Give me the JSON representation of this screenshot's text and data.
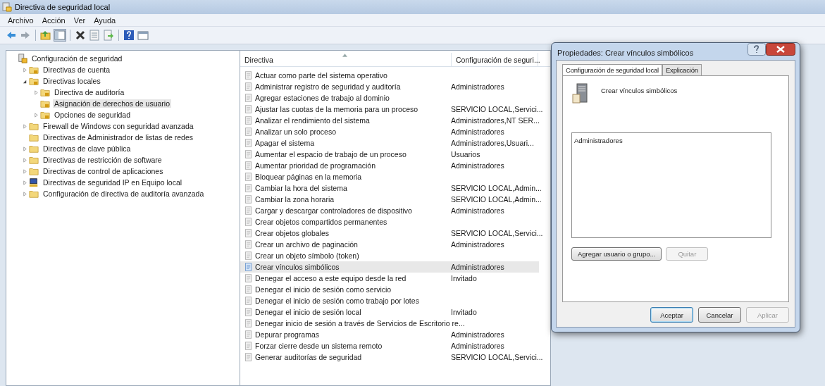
{
  "window": {
    "title": "Directiva de seguridad local"
  },
  "menu": [
    "Archivo",
    "Acción",
    "Ver",
    "Ayuda"
  ],
  "tree": [
    {
      "label": "Configuración de seguridad",
      "kind": "root",
      "expandable": false,
      "selected": false,
      "children": [
        {
          "label": "Directivas de cuenta",
          "kind": "policy-folder",
          "expandable": true,
          "expanded": false,
          "selected": false
        },
        {
          "label": "Directivas locales",
          "kind": "policy-folder",
          "expandable": true,
          "expanded": true,
          "selected": false,
          "children": [
            {
              "label": "Directiva de auditoría",
              "kind": "policy-folder",
              "expandable": true,
              "expanded": false,
              "selected": false
            },
            {
              "label": "Asignación de derechos de usuario",
              "kind": "policy-folder",
              "expandable": false,
              "selected": true
            },
            {
              "label": "Opciones de seguridad",
              "kind": "policy-folder",
              "expandable": true,
              "expanded": false,
              "selected": false
            }
          ]
        },
        {
          "label": "Firewall de Windows con seguridad avanzada",
          "kind": "folder",
          "expandable": true,
          "expanded": false,
          "selected": false
        },
        {
          "label": "Directivas de Administrador de listas de redes",
          "kind": "folder",
          "expandable": false,
          "selected": false
        },
        {
          "label": "Directivas de clave pública",
          "kind": "folder",
          "expandable": true,
          "expanded": false,
          "selected": false
        },
        {
          "label": "Directivas de restricción de software",
          "kind": "folder",
          "expandable": true,
          "expanded": false,
          "selected": false
        },
        {
          "label": "Directivas de control de aplicaciones",
          "kind": "folder",
          "expandable": true,
          "expanded": false,
          "selected": false
        },
        {
          "label": "Directivas de seguridad IP en Equipo local",
          "kind": "computer",
          "expandable": true,
          "expanded": false,
          "selected": false
        },
        {
          "label": "Configuración de directiva de auditoría avanzada",
          "kind": "folder",
          "expandable": true,
          "expanded": false,
          "selected": false
        }
      ]
    }
  ],
  "table": {
    "columns": [
      "Directiva",
      "Configuración de seguri..."
    ],
    "rows": [
      {
        "policy": "Actuar como parte del sistema operativo",
        "setting": "",
        "selected": false
      },
      {
        "policy": "Administrar registro de seguridad y auditoría",
        "setting": "Administradores",
        "selected": false
      },
      {
        "policy": "Agregar estaciones de trabajo al dominio",
        "setting": "",
        "selected": false
      },
      {
        "policy": "Ajustar las cuotas de la memoria para un proceso",
        "setting": "SERVICIO LOCAL,Servici...",
        "selected": false
      },
      {
        "policy": "Analizar el rendimiento del sistema",
        "setting": "Administradores,NT SER...",
        "selected": false
      },
      {
        "policy": "Analizar un solo proceso",
        "setting": "Administradores",
        "selected": false
      },
      {
        "policy": "Apagar el sistema",
        "setting": "Administradores,Usuari...",
        "selected": false
      },
      {
        "policy": "Aumentar el espacio de trabajo de un proceso",
        "setting": "Usuarios",
        "selected": false
      },
      {
        "policy": "Aumentar prioridad de programación",
        "setting": "Administradores",
        "selected": false
      },
      {
        "policy": "Bloquear páginas en la memoria",
        "setting": "",
        "selected": false
      },
      {
        "policy": "Cambiar la hora del sistema",
        "setting": "SERVICIO LOCAL,Admin...",
        "selected": false
      },
      {
        "policy": "Cambiar la zona horaria",
        "setting": "SERVICIO LOCAL,Admin...",
        "selected": false
      },
      {
        "policy": "Cargar y descargar controladores de dispositivo",
        "setting": "Administradores",
        "selected": false
      },
      {
        "policy": "Crear objetos compartidos permanentes",
        "setting": "",
        "selected": false
      },
      {
        "policy": "Crear objetos globales",
        "setting": "SERVICIO LOCAL,Servici...",
        "selected": false
      },
      {
        "policy": "Crear un archivo de paginación",
        "setting": "Administradores",
        "selected": false
      },
      {
        "policy": "Crear un objeto símbolo (token)",
        "setting": "",
        "selected": false
      },
      {
        "policy": "Crear vínculos simbólicos",
        "setting": "Administradores",
        "selected": true
      },
      {
        "policy": "Denegar el acceso a este equipo desde la red",
        "setting": "Invitado",
        "selected": false
      },
      {
        "policy": "Denegar el inicio de sesión como servicio",
        "setting": "",
        "selected": false
      },
      {
        "policy": "Denegar el inicio de sesión como trabajo por lotes",
        "setting": "",
        "selected": false
      },
      {
        "policy": "Denegar el inicio de sesión local",
        "setting": "Invitado",
        "selected": false
      },
      {
        "policy": "Denegar inicio de sesión a través de Servicios de Escritorio re...",
        "setting": "",
        "selected": false
      },
      {
        "policy": "Depurar programas",
        "setting": "Administradores",
        "selected": false
      },
      {
        "policy": "Forzar cierre desde un sistema remoto",
        "setting": "Administradores",
        "selected": false
      },
      {
        "policy": "Generar auditorías de seguridad",
        "setting": "SERVICIO LOCAL,Servici...",
        "selected": false
      }
    ]
  },
  "dialog": {
    "title": "Propiedades: Crear vínculos simbólicos",
    "tabs": [
      {
        "label": "Configuración de seguridad local",
        "selected": true
      },
      {
        "label": "Explicación",
        "selected": false
      }
    ],
    "policy_name": "Crear vínculos simbólicos",
    "members": [
      "Administradores"
    ],
    "list_buttons": [
      {
        "label": "Agregar usuario o grupo...",
        "disabled": false
      },
      {
        "label": "Quitar",
        "disabled": true
      }
    ],
    "buttons": [
      {
        "label": "Aceptar",
        "disabled": false,
        "default": true
      },
      {
        "label": "Cancelar",
        "disabled": false,
        "default": false
      },
      {
        "label": "Aplicar",
        "disabled": true,
        "default": false
      }
    ]
  }
}
